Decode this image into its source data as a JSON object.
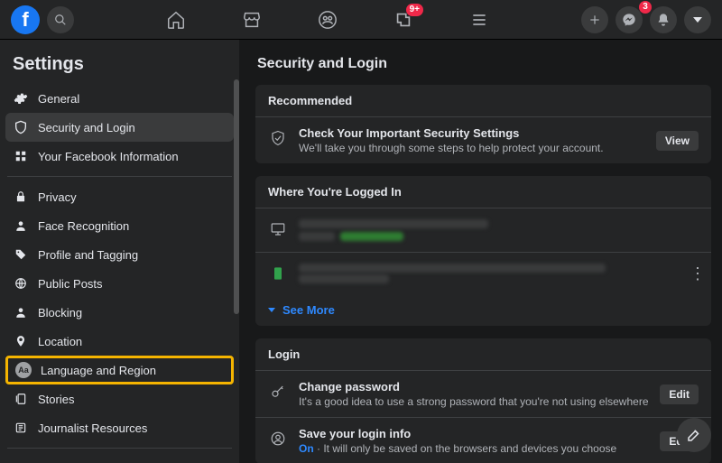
{
  "topbar": {
    "gaming_badge": "9+",
    "messenger_badge": "3"
  },
  "sidebar": {
    "title": "Settings",
    "items": [
      {
        "label": "General",
        "icon": "gear-icon"
      },
      {
        "label": "Security and Login",
        "icon": "shield-icon",
        "active": true
      },
      {
        "label": "Your Facebook Information",
        "icon": "grid-icon"
      },
      {
        "label": "Privacy",
        "icon": "lock-icon"
      },
      {
        "label": "Face Recognition",
        "icon": "person-icon"
      },
      {
        "label": "Profile and Tagging",
        "icon": "tag-icon"
      },
      {
        "label": "Public Posts",
        "icon": "globe-icon"
      },
      {
        "label": "Blocking",
        "icon": "person-icon"
      },
      {
        "label": "Location",
        "icon": "pin-icon"
      },
      {
        "label": "Language and Region",
        "icon": "language-icon",
        "highlight": true
      },
      {
        "label": "Stories",
        "icon": "stories-icon"
      },
      {
        "label": "Journalist Resources",
        "icon": "journalist-icon"
      }
    ]
  },
  "main": {
    "title": "Security and Login",
    "recommended": {
      "header": "Recommended",
      "title": "Check Your Important Security Settings",
      "sub": "We'll take you through some steps to help protect your account.",
      "action": "View"
    },
    "sessions": {
      "header": "Where You're Logged In",
      "see_more": "See More"
    },
    "login": {
      "header": "Login",
      "change_password_title": "Change password",
      "change_password_sub": "It's a good idea to use a strong password that you're not using elsewhere",
      "edit": "Edit",
      "save_login_title": "Save your login info",
      "save_login_state": "On",
      "save_login_sub": " · It will only be saved on the browsers and devices you choose"
    }
  }
}
